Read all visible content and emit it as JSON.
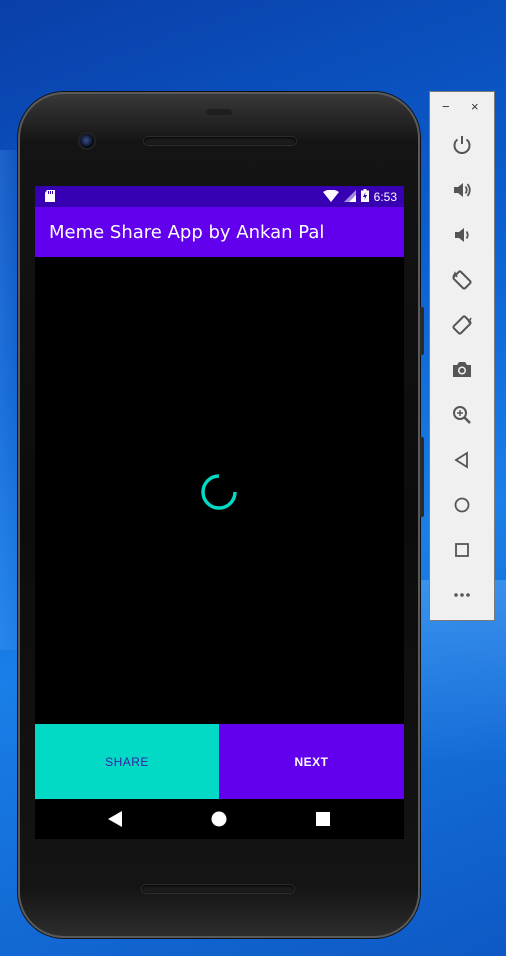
{
  "status_bar": {
    "time": "6:53",
    "icons": [
      "sd-card-icon",
      "wifi-icon",
      "signal-icon",
      "battery-icon"
    ]
  },
  "app_bar": {
    "title": "Meme Share App by Ankan Pal"
  },
  "content": {
    "loading": true
  },
  "buttons": {
    "share_label": "SHARE",
    "next_label": "NEXT"
  },
  "nav_bar": {
    "icons": [
      "back-icon",
      "home-icon",
      "recents-icon"
    ]
  },
  "emulator_toolbar": {
    "window_controls": [
      "−",
      "×"
    ],
    "items": [
      "power-icon",
      "volume-up-icon",
      "volume-down-icon",
      "rotate-left-icon",
      "rotate-right-icon",
      "camera-icon",
      "zoom-icon",
      "back-icon",
      "home-icon",
      "overview-icon",
      "more-icon"
    ]
  },
  "colors": {
    "status_bar": "#3700b3",
    "app_bar": "#6200ee",
    "share_button": "#03dac5",
    "next_button": "#6200ee",
    "spinner": "#03dac5"
  }
}
